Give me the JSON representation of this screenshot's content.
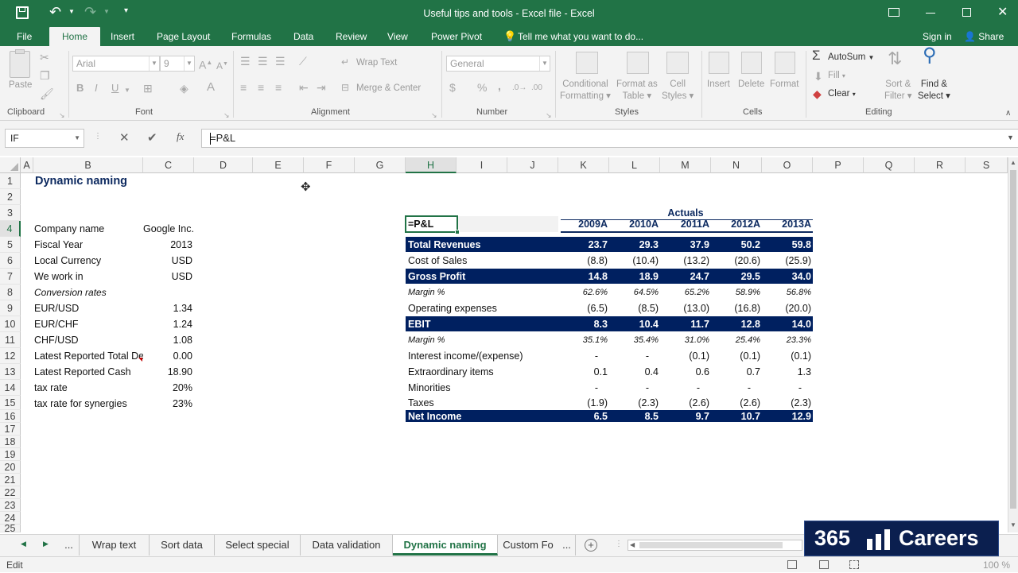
{
  "window": {
    "title": "Useful tips and tools - Excel file - Excel"
  },
  "ribbon_tabs": [
    "File",
    "Home",
    "Insert",
    "Page Layout",
    "Formulas",
    "Data",
    "Review",
    "View",
    "Power Pivot"
  ],
  "tell_me": "Tell me what you want to do...",
  "sign_in": "Sign in",
  "share": "Share",
  "ribbon": {
    "clipboard": {
      "paste": "Paste",
      "label": "Clipboard"
    },
    "font": {
      "family": "Arial",
      "size": "9",
      "label": "Font",
      "bold": "B",
      "italic": "I",
      "underline": "U",
      "grow": "A",
      "shrink": "A",
      "color": "A"
    },
    "alignment": {
      "wrap": "Wrap Text",
      "merge": "Merge & Center",
      "label": "Alignment"
    },
    "number": {
      "format": "General",
      "percent": "%",
      "comma": ",",
      "label": "Number"
    },
    "styles": {
      "cond1": "Conditional",
      "cond2": "Formatting",
      "fmt1": "Format as",
      "fmt2": "Table",
      "cell1": "Cell",
      "cell2": "Styles",
      "label": "Styles"
    },
    "cells": {
      "insert": "Insert",
      "delete": "Delete",
      "format": "Format",
      "label": "Cells"
    },
    "editing": {
      "autosum": "AutoSum",
      "fill": "Fill",
      "clear": "Clear",
      "sort1": "Sort &",
      "sort2": "Filter",
      "find1": "Find &",
      "find2": "Select",
      "label": "Editing"
    }
  },
  "formula_bar": {
    "name_box": "IF",
    "formula": "=P&L",
    "cancel": "✕",
    "enter": "✔",
    "fx": "fx"
  },
  "columns": [
    "A",
    "B",
    "C",
    "D",
    "E",
    "F",
    "G",
    "H",
    "I",
    "J",
    "K",
    "L",
    "M",
    "N",
    "O",
    "P",
    "Q",
    "R",
    "S"
  ],
  "rows": [
    "1",
    "2",
    "3",
    "4",
    "5",
    "6",
    "7",
    "8",
    "9",
    "10",
    "11",
    "12",
    "13",
    "14",
    "15",
    "16",
    "17",
    "18",
    "19",
    "20",
    "21",
    "22",
    "23",
    "24",
    "25"
  ],
  "sheet": {
    "title": "Dynamic naming",
    "inputs": [
      {
        "label": "Company name",
        "value": "Google Inc."
      },
      {
        "label": "Fiscal Year",
        "value": "2013"
      },
      {
        "label": "Local Currency",
        "value": "USD"
      },
      {
        "label": "We work in",
        "value": "USD"
      },
      {
        "label": "Conversion rates",
        "value": ""
      },
      {
        "label": "EUR/USD",
        "value": "1.34"
      },
      {
        "label": "EUR/CHF",
        "value": "1.24"
      },
      {
        "label": "CHF/USD",
        "value": "1.08"
      },
      {
        "label": "Latest Reported Total De",
        "value": "0.00"
      },
      {
        "label": "Latest Reported Cash",
        "value": "18.90"
      },
      {
        "label": "tax rate",
        "value": "20%"
      },
      {
        "label": "tax rate for synergies",
        "value": "23%"
      }
    ],
    "pl": {
      "editing_cell": "=P&L",
      "actuals": "Actuals",
      "years": [
        "2009A",
        "2010A",
        "2011A",
        "2012A",
        "2013A"
      ],
      "lines": [
        {
          "label": "Total Revenues",
          "values": [
            "23.7",
            "29.3",
            "37.9",
            "50.2",
            "59.8"
          ]
        },
        {
          "label": "Cost of Sales",
          "values": [
            "(8.8)",
            "(10.4)",
            "(13.2)",
            "(20.6)",
            "(25.9)"
          ]
        },
        {
          "label": "Gross Profit",
          "values": [
            "14.8",
            "18.9",
            "24.7",
            "29.5",
            "34.0"
          ]
        },
        {
          "label": "Margin %",
          "values": [
            "62.6%",
            "64.5%",
            "65.2%",
            "58.9%",
            "56.8%"
          ]
        },
        {
          "label": "Operating expenses",
          "values": [
            "(6.5)",
            "(8.5)",
            "(13.0)",
            "(16.8)",
            "(20.0)"
          ]
        },
        {
          "label": "EBIT",
          "values": [
            "8.3",
            "10.4",
            "11.7",
            "12.8",
            "14.0"
          ]
        },
        {
          "label": "Margin %",
          "values": [
            "35.1%",
            "35.4%",
            "31.0%",
            "25.4%",
            "23.3%"
          ]
        },
        {
          "label": "Interest income/(expense)",
          "values": [
            "-",
            "-",
            "(0.1)",
            "(0.1)",
            "(0.1)"
          ]
        },
        {
          "label": "Extraordinary items",
          "values": [
            "0.1",
            "0.4",
            "0.6",
            "0.7",
            "1.3"
          ]
        },
        {
          "label": "Minorities",
          "values": [
            "-",
            "-",
            "-",
            "-",
            "-"
          ]
        },
        {
          "label": "Taxes",
          "values": [
            "(1.9)",
            "(2.3)",
            "(2.6)",
            "(2.6)",
            "(2.3)"
          ]
        },
        {
          "label": "Net Income",
          "values": [
            "6.5",
            "8.5",
            "9.7",
            "10.7",
            "12.9"
          ]
        }
      ]
    }
  },
  "sheet_tabs": [
    "...",
    "Wrap text",
    "Sort data",
    "Select special",
    "Data validation",
    "Dynamic naming",
    "Custom Fo",
    "..."
  ],
  "status": {
    "mode": "Edit",
    "zoom": "100 %"
  },
  "brand": {
    "logo_num": "365",
    "logo_text": "Careers"
  },
  "colors": {
    "excel_green": "#217346",
    "band_navy": "#002060",
    "logo_bg": "#0b1f4f"
  }
}
